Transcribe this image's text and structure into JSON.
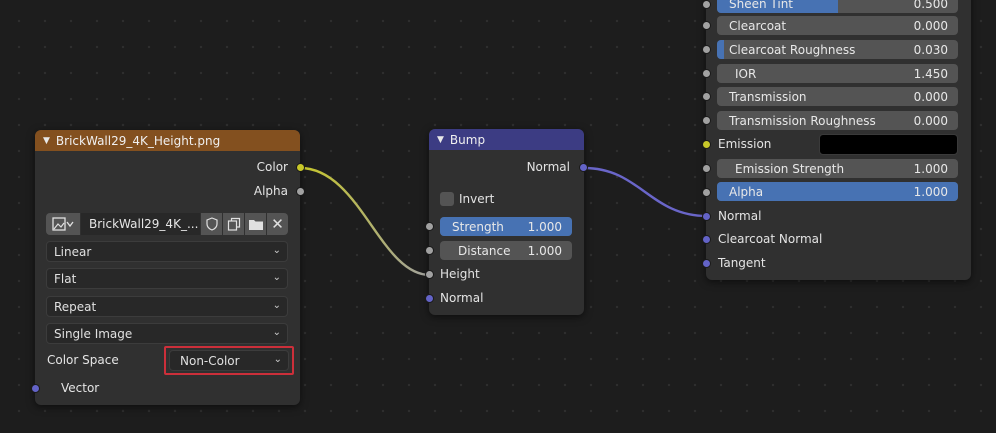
{
  "colors": {
    "image_header": "#83501f",
    "bump_header": "#3c3c83",
    "socket_color": "#c7c729",
    "socket_float": "#a1a1a1",
    "socket_vector": "#6363c7",
    "accent": "#4772b3",
    "highlight": "#cc2f3a"
  },
  "image_node": {
    "title": "BrickWall29_4K_Height.png",
    "outputs": {
      "color": "Color",
      "alpha": "Alpha"
    },
    "image_name": "BrickWall29_4K_...",
    "interpolation": "Linear",
    "projection": "Flat",
    "extension": "Repeat",
    "source": "Single Image",
    "color_space_label": "Color Space",
    "color_space_value": "Non-Color",
    "inputs": {
      "vector": "Vector"
    }
  },
  "bump_node": {
    "title": "Bump",
    "outputs": {
      "normal": "Normal"
    },
    "invert_label": "Invert",
    "strength": {
      "label": "Strength",
      "value": "1.000",
      "fraction": 1.0
    },
    "distance": {
      "label": "Distance",
      "value": "1.000"
    },
    "inputs": {
      "height": "Height",
      "normal": "Normal"
    }
  },
  "bsdf_node": {
    "sheen_tint": {
      "label": "Sheen Tint",
      "value": "0.500",
      "fraction": 0.5
    },
    "clearcoat": {
      "label": "Clearcoat",
      "value": "0.000"
    },
    "clearcoat_roughness": {
      "label": "Clearcoat Roughness",
      "value": "0.030",
      "fraction": 0.03
    },
    "ior": {
      "label": "IOR",
      "value": "1.450"
    },
    "transmission": {
      "label": "Transmission",
      "value": "0.000"
    },
    "transmission_roughness": {
      "label": "Transmission Roughness",
      "value": "0.000"
    },
    "emission_label": "Emission",
    "emission_color": "#000000",
    "emission_strength": {
      "label": "Emission Strength",
      "value": "1.000"
    },
    "alpha": {
      "label": "Alpha",
      "value": "1.000",
      "fraction": 1.0
    },
    "normal_label": "Normal",
    "clearcoat_normal_label": "Clearcoat Normal",
    "tangent_label": "Tangent"
  }
}
